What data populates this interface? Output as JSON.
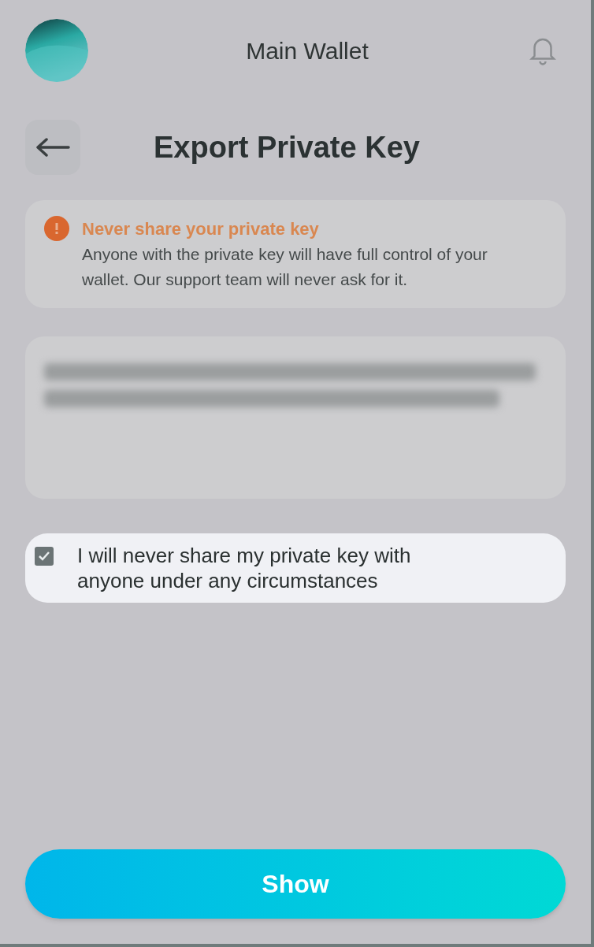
{
  "header": {
    "title": "Main Wallet"
  },
  "page": {
    "title": "Export Private Key"
  },
  "warning": {
    "title": "Never share your private key",
    "text": "Anyone with the private key will have full control of your wallet. Our support team will never ask for it."
  },
  "private_key": {
    "revealed": false
  },
  "agreement": {
    "label": "I will never share my private key with anyone under any circumstances",
    "checked": true
  },
  "buttons": [
    {
      "label": "Show"
    }
  ]
}
